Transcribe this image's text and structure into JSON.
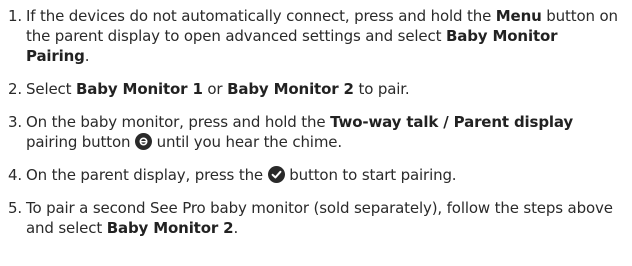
{
  "steps": [
    {
      "num": "1.",
      "t1": "If the devices do not automatically connect, press and hold the ",
      "b1": "Menu",
      "t2": " button on the parent display to open advanced settings and select ",
      "b2": "Baby Monitor Pairing",
      "t3": "."
    },
    {
      "num": "2.",
      "t1": "Select ",
      "b1": "Baby Monitor 1",
      "t2": " or ",
      "b2": "Baby Monitor 2",
      "t3": " to pair."
    },
    {
      "num": "3.",
      "t1": "On the baby monitor, press and hold the ",
      "b1": "Two-way talk / Parent display",
      "t2": " pairing button ",
      "icon": "pairing-button-icon",
      "t3": " until you hear the chime."
    },
    {
      "num": "4.",
      "t1": "On the parent display, press the ",
      "icon": "confirm-button-icon",
      "t2": " button to start pairing."
    },
    {
      "num": "5.",
      "t1": "To pair a second See Pro baby monitor (sold separately), follow the steps above and select ",
      "b1": "Baby Monitor 2",
      "t2": "."
    }
  ],
  "colors": {
    "text": "#2a2a2a",
    "icon": "#2a2a2a"
  }
}
